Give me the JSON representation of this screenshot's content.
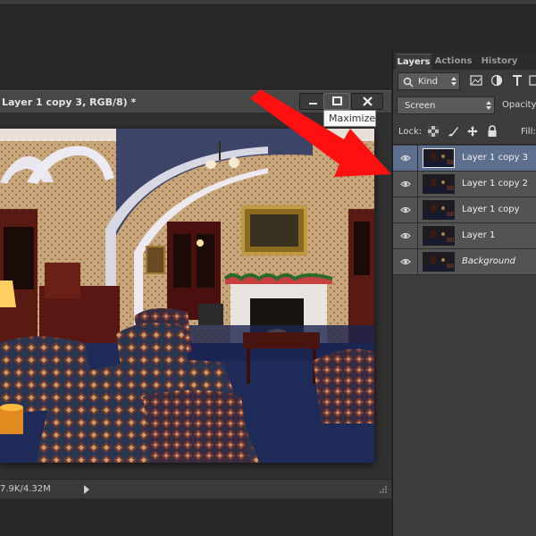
{
  "document": {
    "title": "Layer 1 copy 3, RGB/8) *",
    "tooltip": "Maximize",
    "status": "7.9K/4.32M"
  },
  "layers_panel": {
    "tabs": [
      {
        "label": "Layers",
        "active": true
      },
      {
        "label": "Actions",
        "active": false
      },
      {
        "label": "History",
        "active": false
      }
    ],
    "filter_kind": "Kind",
    "blend_mode": "Screen",
    "opacity_label": "Opacity:",
    "lock_label": "Lock:",
    "fill_label": "Fill:",
    "layers": [
      {
        "name": "Layer 1 copy 3",
        "selected": true,
        "italic": false
      },
      {
        "name": "Layer 1 copy 2",
        "selected": false,
        "italic": false
      },
      {
        "name": "Layer 1 copy",
        "selected": false,
        "italic": false
      },
      {
        "name": "Layer 1",
        "selected": false,
        "italic": false
      },
      {
        "name": "Background",
        "selected": false,
        "italic": true
      }
    ]
  },
  "colors": {
    "panel_bg": "#3c3c3c",
    "selected_layer": "#5d6f8e",
    "annotation_arrow": "#ff1010"
  }
}
